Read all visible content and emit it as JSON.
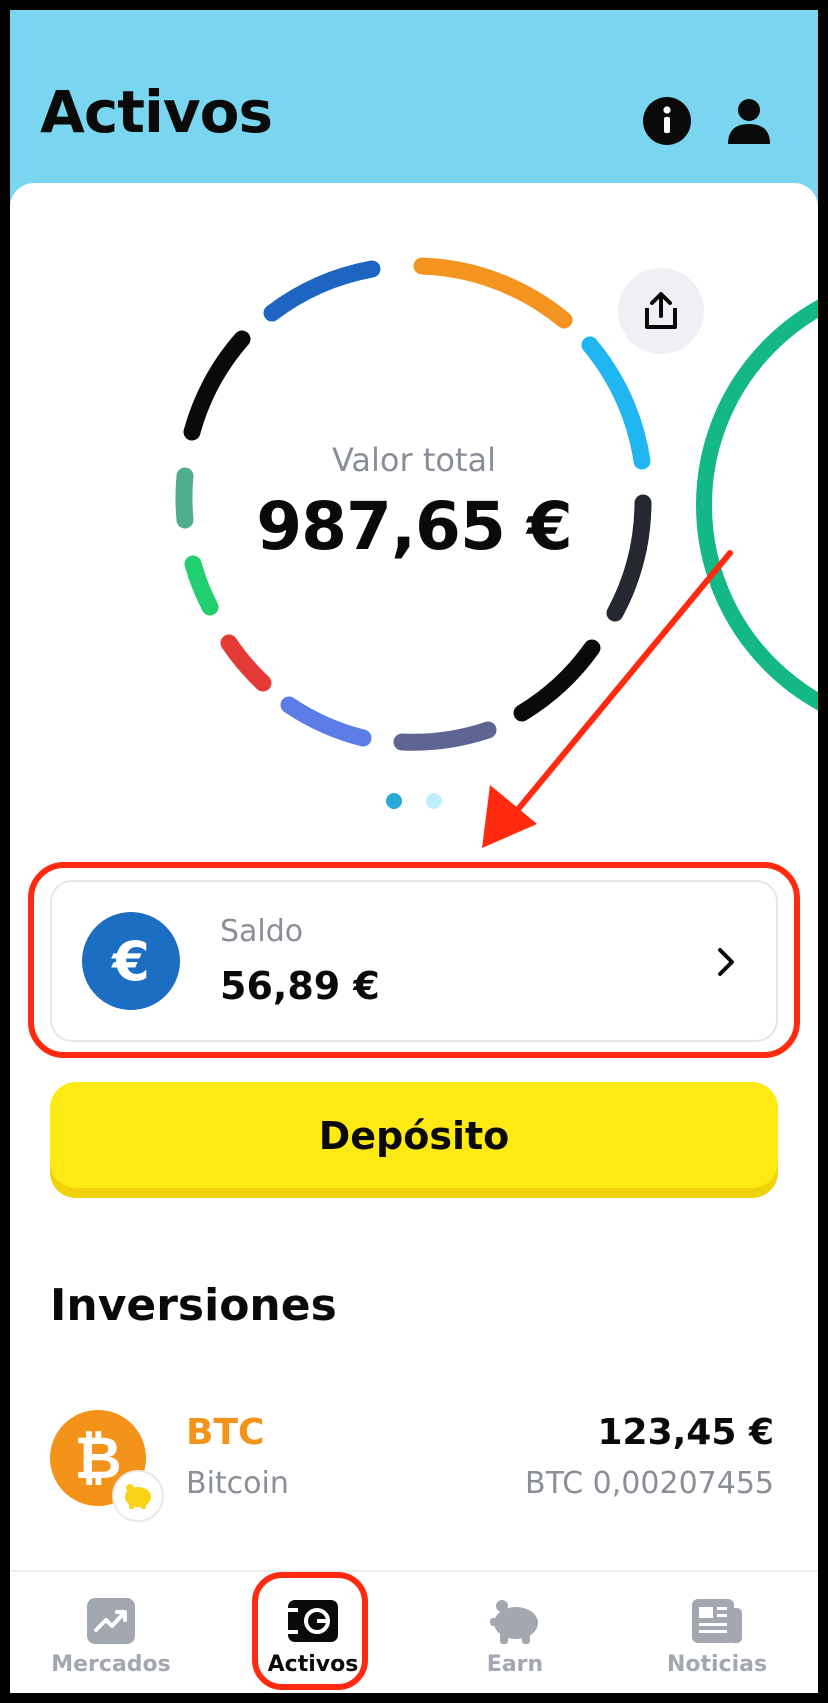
{
  "header": {
    "title": "Activos"
  },
  "portfolio": {
    "label": "Valor total",
    "total": "987,65 €"
  },
  "saldo": {
    "label": "Saldo",
    "value": "56,89 €",
    "currency_symbol": "€"
  },
  "deposit": {
    "label": "Depósito"
  },
  "investments": {
    "title": "Inversiones",
    "items": [
      {
        "symbol": "BTC",
        "name": "Bitcoin",
        "value": "123,45 €",
        "amount": "BTC 0,00207455",
        "icon_letter": "₿"
      }
    ]
  },
  "nav": {
    "items": [
      {
        "label": "Mercados",
        "icon": "chart-icon",
        "active": false
      },
      {
        "label": "Activos",
        "icon": "wallet-icon",
        "active": true
      },
      {
        "label": "Earn",
        "icon": "piggy-bank-icon",
        "active": false
      },
      {
        "label": "Noticias",
        "icon": "news-icon",
        "active": false
      }
    ]
  },
  "colors": {
    "header_bg": "#7ad6f0",
    "accent_yellow": "#fde914",
    "btc_orange": "#f4931a",
    "euro_blue": "#1c6ec2",
    "annotation_red": "#ff2a10"
  },
  "annotations": {
    "pagination_total": 2,
    "pagination_current": 1
  }
}
